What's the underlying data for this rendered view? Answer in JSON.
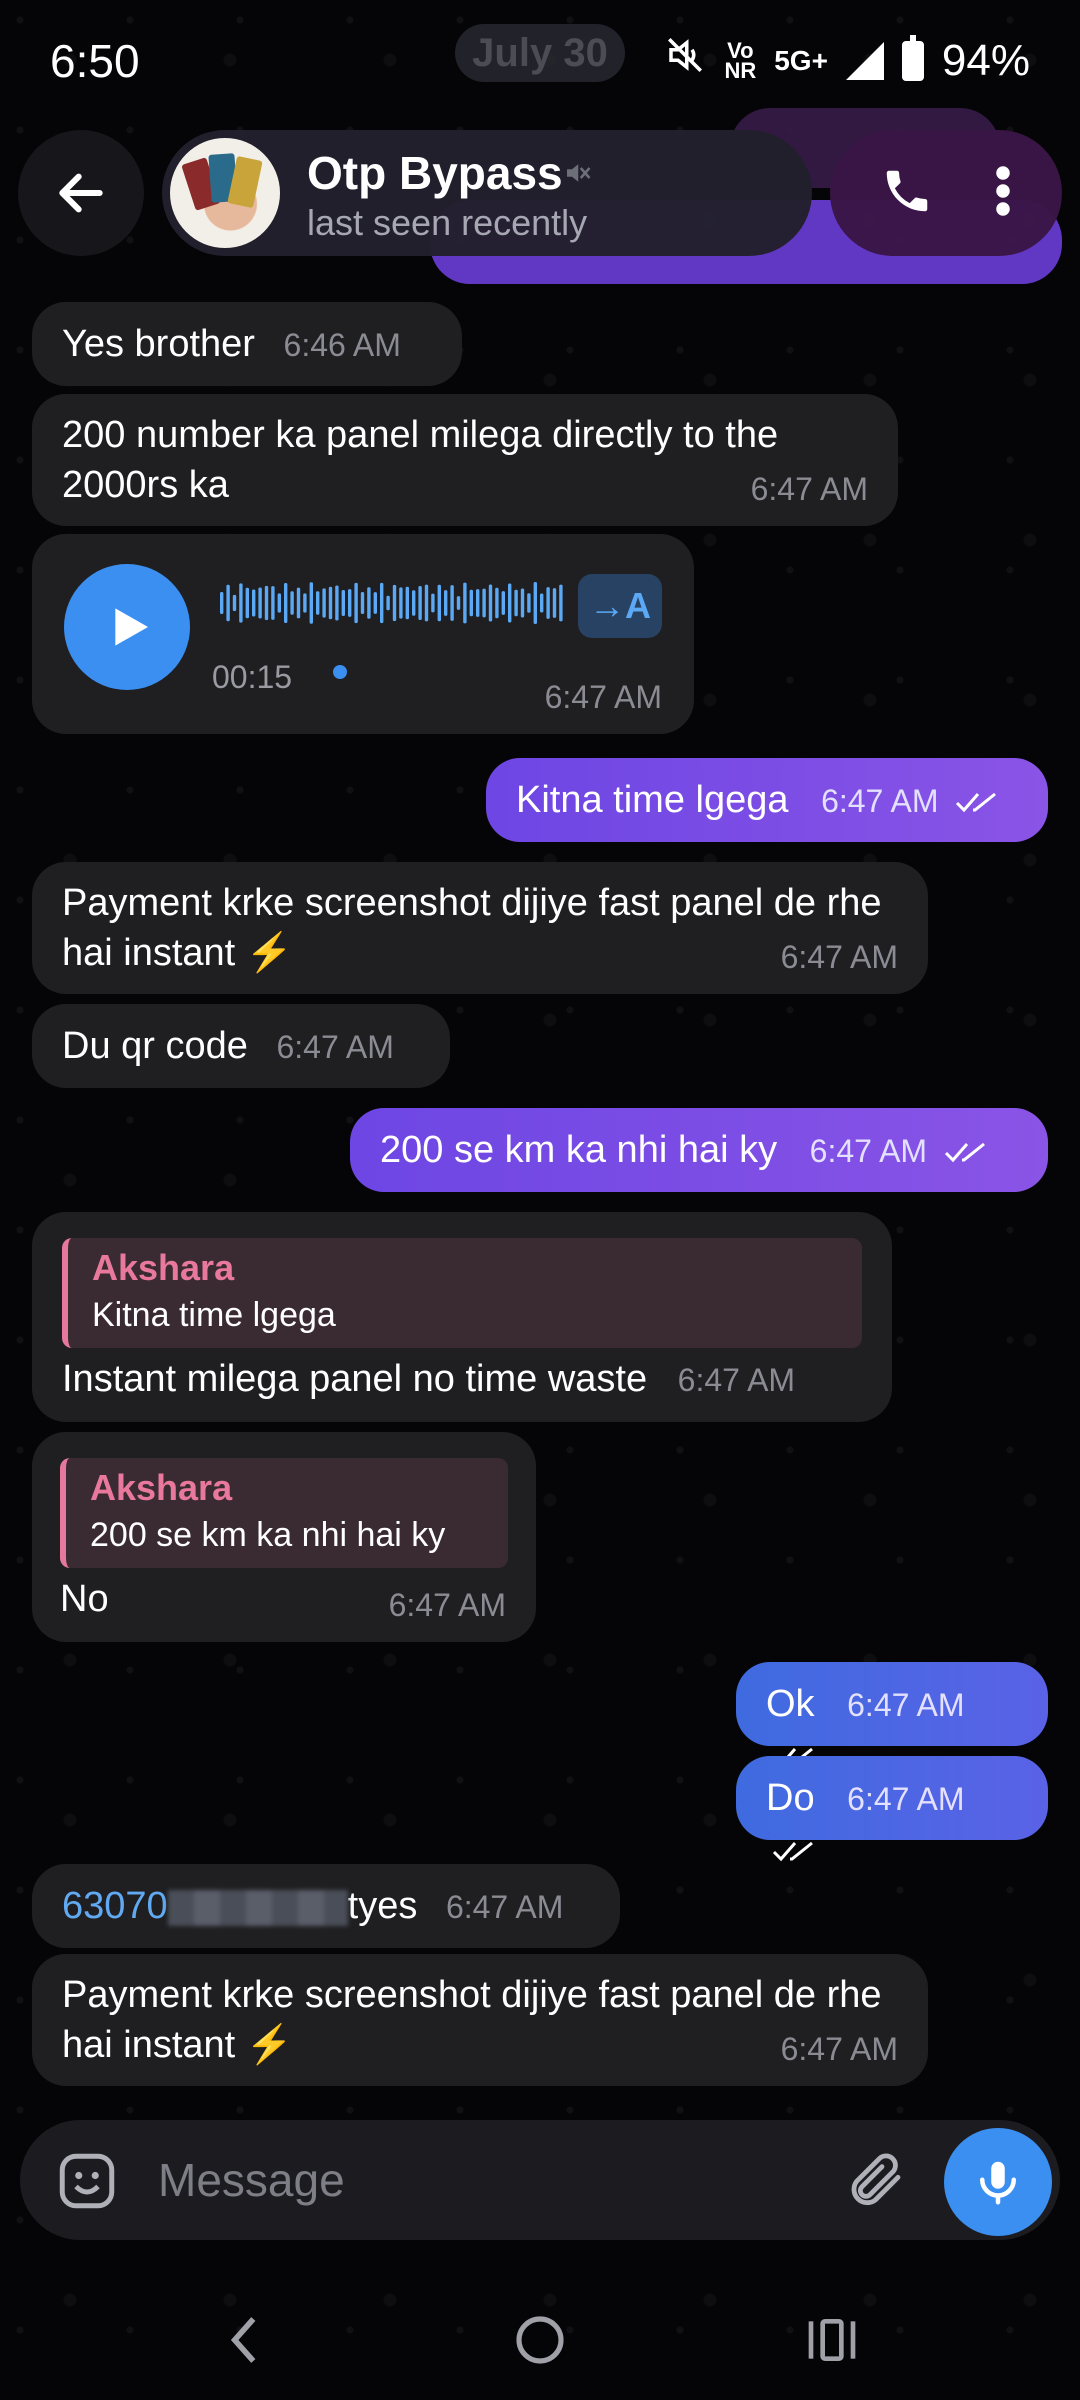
{
  "status_bar": {
    "time": "6:50",
    "date_pill": "July 30",
    "volte_top": "Vo",
    "volte_bottom": "NR",
    "network": "5G+",
    "battery": "94%"
  },
  "header": {
    "chat_name": "Otp Bypass",
    "chat_status": "last seen recently",
    "icons": [
      "back-arrow-icon",
      "muted-icon",
      "phone-icon",
      "more-vert-icon"
    ]
  },
  "messages": [
    {
      "dir": "in",
      "text": "Yes brother",
      "time": "6:46 AM"
    },
    {
      "dir": "in",
      "text": "200 number ka panel milega directly to the 2000rs ka",
      "time": "6:47 AM"
    },
    {
      "dir": "in",
      "type": "voice",
      "duration": "00:15",
      "transcribe_label": "→A",
      "time": "6:47 AM"
    },
    {
      "dir": "out",
      "text": "Kitna time lgega",
      "time": "6:47 AM"
    },
    {
      "dir": "in",
      "text": "Payment krke screenshot dijiye fast panel de rhe hai instant ⚡",
      "time": "6:47 AM"
    },
    {
      "dir": "in",
      "text": "Du qr code",
      "time": "6:47 AM"
    },
    {
      "dir": "out",
      "text": "200 se km ka nhi hai ky",
      "time": "6:47 AM"
    },
    {
      "dir": "in",
      "reply_author": "Akshara",
      "reply_text": "Kitna time lgega",
      "text": "Instant milega panel no time waste",
      "time": "6:47 AM"
    },
    {
      "dir": "in",
      "reply_author": "Akshara",
      "reply_text": "200 se km ka nhi hai ky",
      "text": "No",
      "time": "6:47 AM"
    },
    {
      "dir": "out",
      "text": "Ok",
      "time": "6:47 AM"
    },
    {
      "dir": "out",
      "text": "Do",
      "time": "6:47 AM"
    },
    {
      "dir": "in",
      "link_prefix": "63070",
      "text_suffix": "tyes",
      "time": "6:47 AM"
    },
    {
      "dir": "in",
      "text": "Payment krke screenshot dijiye fast panel de rhe hai instant ⚡",
      "time": "6:47 AM"
    }
  ],
  "input": {
    "placeholder": "Message",
    "icons": [
      "sticker-icon",
      "attach-icon",
      "mic-icon"
    ]
  },
  "colors": {
    "incoming_bubble": "#1f1f22",
    "outgoing_bubble": "#7a4ee6",
    "accent_blue": "#3a8ff0",
    "reply_pink": "#e8799c"
  }
}
